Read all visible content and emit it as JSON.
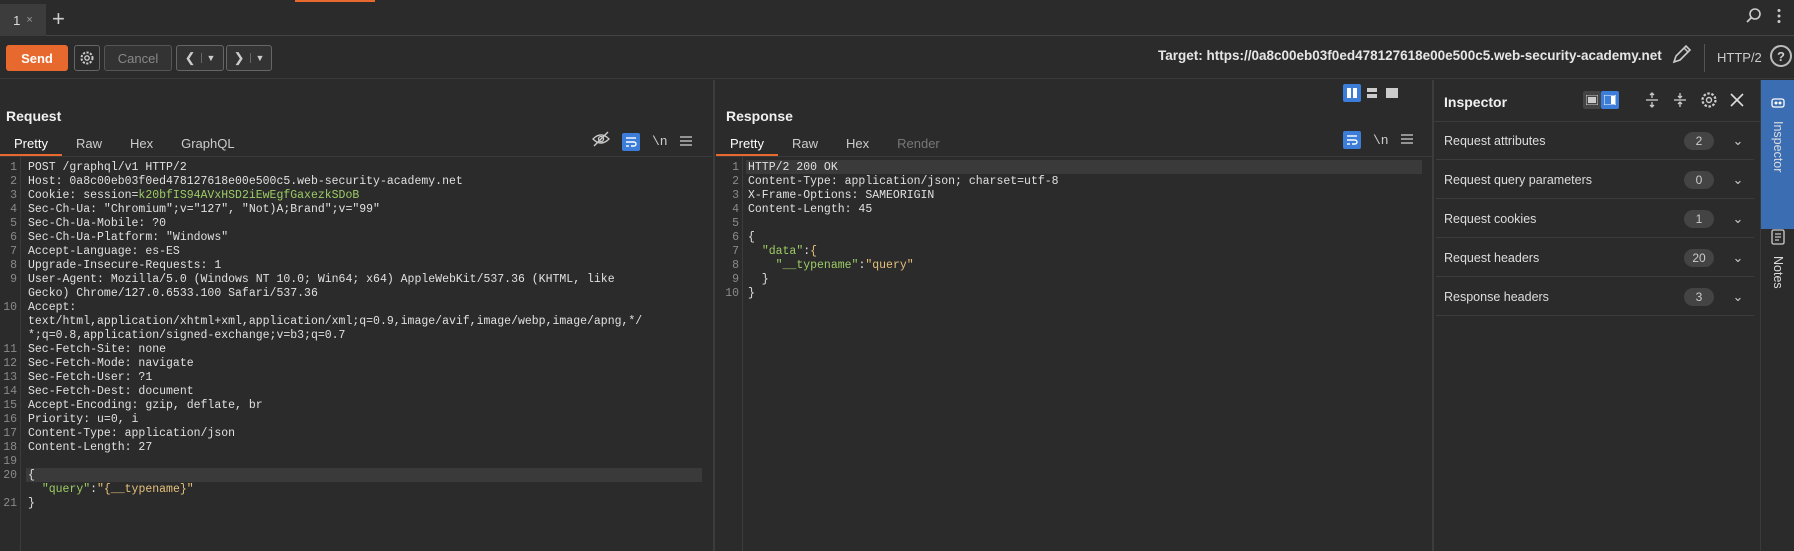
{
  "tabbar": {
    "tab_label": "1",
    "tab_close": "×",
    "add": "+"
  },
  "toolbar": {
    "send_label": "Send",
    "cancel_label": "Cancel",
    "target_label": "Target: https://0a8c00eb03f0ed478127618e00e500c5.web-security-academy.net",
    "protocol": "HTTP/2",
    "help": "?"
  },
  "request": {
    "title": "Request",
    "tabs": [
      "Pretty",
      "Raw",
      "Hex",
      "GraphQL"
    ],
    "newline_label": "\\n",
    "lines": [
      {
        "n": "1",
        "t": "POST /graphql/v1 HTTP/2"
      },
      {
        "n": "2",
        "t": "Host: 0a8c00eb03f0ed478127618e00e500c5.web-security-academy.net"
      },
      {
        "n": "3",
        "t": "Cookie: session=",
        "cookie": "k20bfIS94AVxHSD2iEwEgfGaxezkSDoB"
      },
      {
        "n": "4",
        "t": "Sec-Ch-Ua: \"Chromium\";v=\"127\", \"Not)A;Brand\";v=\"99\""
      },
      {
        "n": "5",
        "t": "Sec-Ch-Ua-Mobile: ?0"
      },
      {
        "n": "6",
        "t": "Sec-Ch-Ua-Platform: \"Windows\""
      },
      {
        "n": "7",
        "t": "Accept-Language: es-ES"
      },
      {
        "n": "8",
        "t": "Upgrade-Insecure-Requests: 1"
      },
      {
        "n": "9",
        "t": "User-Agent: Mozilla/5.0 (Windows NT 10.0; Win64; x64) AppleWebKit/537.36 (KHTML, like"
      },
      {
        "n": "",
        "t": "Gecko) Chrome/127.0.6533.100 Safari/537.36"
      },
      {
        "n": "10",
        "t": "Accept:"
      },
      {
        "n": "",
        "t": "text/html,application/xhtml+xml,application/xml;q=0.9,image/avif,image/webp,image/apng,*/"
      },
      {
        "n": "",
        "t": "*;q=0.8,application/signed-exchange;v=b3;q=0.7"
      },
      {
        "n": "11",
        "t": "Sec-Fetch-Site: none"
      },
      {
        "n": "12",
        "t": "Sec-Fetch-Mode: navigate"
      },
      {
        "n": "13",
        "t": "Sec-Fetch-User: ?1"
      },
      {
        "n": "14",
        "t": "Sec-Fetch-Dest: document"
      },
      {
        "n": "15",
        "t": "Accept-Encoding: gzip, deflate, br"
      },
      {
        "n": "16",
        "t": "Priority: u=0, i"
      },
      {
        "n": "17",
        "t": "Content-Type: application/json"
      },
      {
        "n": "18",
        "t": "Content-Length: 27"
      },
      {
        "n": "19",
        "t": ""
      },
      {
        "n": "20",
        "t": "{"
      },
      {
        "n": "",
        "t": "  \"query\":\"{__typename}\""
      },
      {
        "n": "21",
        "t": "}"
      }
    ]
  },
  "response": {
    "title": "Response",
    "tabs": [
      "Pretty",
      "Raw",
      "Hex",
      "Render"
    ],
    "newline_label": "\\n",
    "lines": [
      {
        "n": "1",
        "t": "HTTP/2 200 OK"
      },
      {
        "n": "2",
        "t": "Content-Type: application/json; charset=utf-8"
      },
      {
        "n": "3",
        "t": "X-Frame-Options: SAMEORIGIN"
      },
      {
        "n": "4",
        "t": "Content-Length: 45"
      },
      {
        "n": "5",
        "t": ""
      },
      {
        "n": "6",
        "t": "{"
      },
      {
        "n": "7",
        "t": "  \"data\":{"
      },
      {
        "n": "8",
        "t": "    \"__typename\":\"query\""
      },
      {
        "n": "9",
        "t": "  }"
      },
      {
        "n": "10",
        "t": "}"
      }
    ]
  },
  "inspector": {
    "title": "Inspector",
    "rows": [
      {
        "label": "Request attributes",
        "count": "2"
      },
      {
        "label": "Request query parameters",
        "count": "0"
      },
      {
        "label": "Request cookies",
        "count": "1"
      },
      {
        "label": "Request headers",
        "count": "20"
      },
      {
        "label": "Response headers",
        "count": "3"
      }
    ]
  },
  "siderail": {
    "inspector_label": "Inspector",
    "notes_label": "Notes"
  },
  "colors": {
    "accent": "#e8692d",
    "toggle_on": "#3b7dd8",
    "cookie": "#9ccc65"
  }
}
